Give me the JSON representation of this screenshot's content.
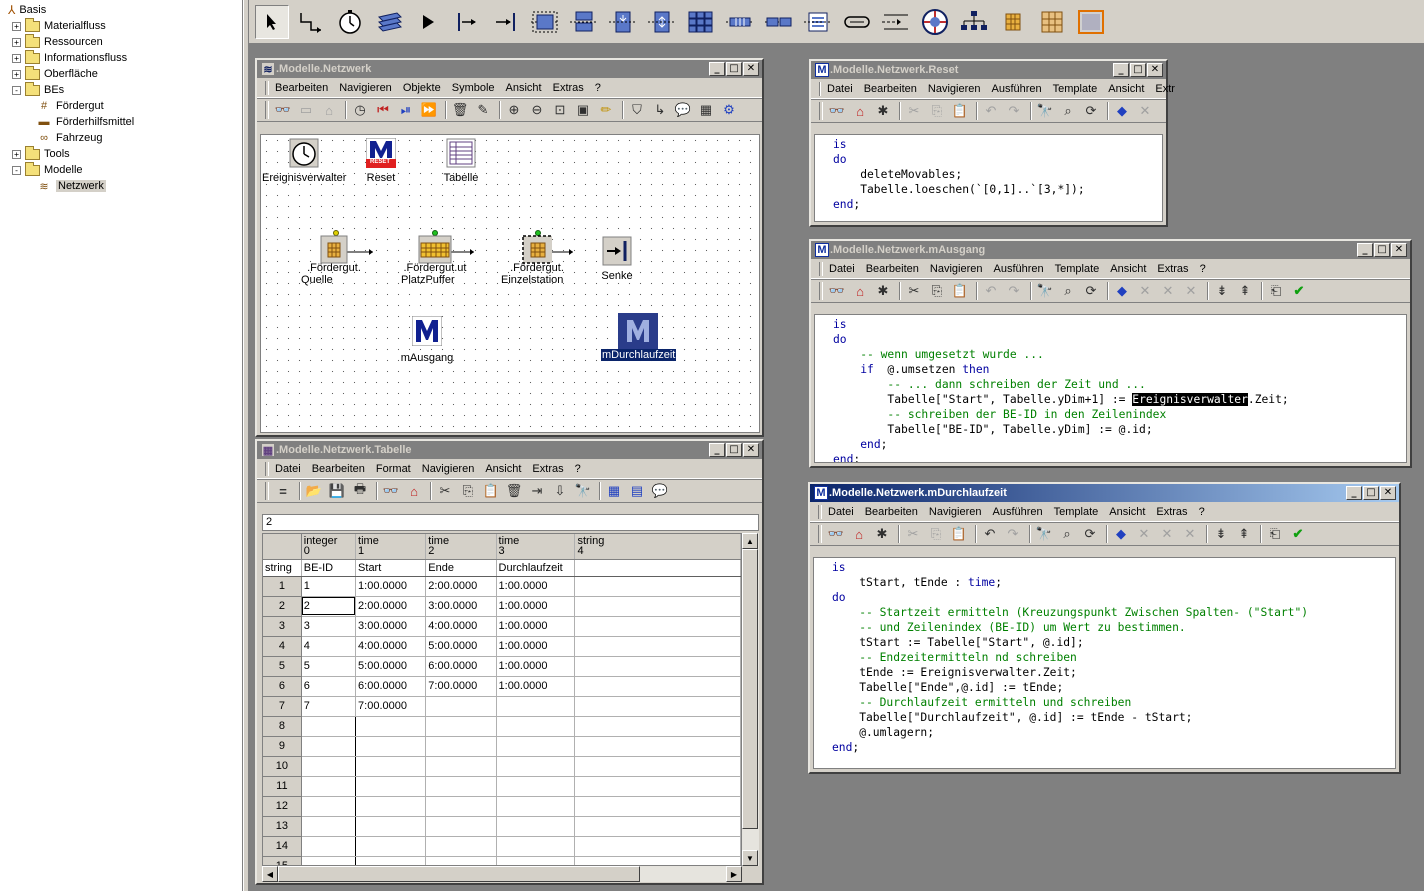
{
  "tree": {
    "root": "Basis",
    "items": [
      {
        "label": "Materialfluss",
        "toggle": "+"
      },
      {
        "label": "Ressourcen",
        "toggle": "+"
      },
      {
        "label": "Informationsfluss",
        "toggle": "+"
      },
      {
        "label": "Oberfläche",
        "toggle": "+"
      },
      {
        "label": "BEs",
        "toggle": "-"
      },
      {
        "label": "Fördergut"
      },
      {
        "label": "Förderhilfsmittel"
      },
      {
        "label": "Fahrzeug"
      },
      {
        "label": "Tools",
        "toggle": "+"
      },
      {
        "label": "Modelle",
        "toggle": "-"
      },
      {
        "label": "Netzwerk",
        "selected": true
      }
    ]
  },
  "netzwerk": {
    "title": ".Modelle.Netzwerk",
    "menu": [
      "Bearbeiten",
      "Navigieren",
      "Objekte",
      "Symbole",
      "Ansicht",
      "Extras",
      "?"
    ],
    "nodes": {
      "ereignisverwalter": "Ereignisverwalter",
      "reset": "Reset",
      "reset_badge": "RESET",
      "tabelle": "Tabelle",
      "quelle_a": ".Fördergut.",
      "quelle_b": "Quelle",
      "puffer_a": ".Fördergut.ut",
      "puffer_b": "PlatzPuffer",
      "einzel_a": ".Fördergut.",
      "einzel_b": "Einzelstation",
      "senke": "Senke",
      "mausgang": "mAusgang",
      "mdurchlauf": "mDurchlaufzeit",
      "m": "M"
    }
  },
  "tabelle": {
    "title": ".Modelle.Netzwerk.Tabelle",
    "menu": [
      "Datei",
      "Bearbeiten",
      "Format",
      "Navigieren",
      "Ansicht",
      "Extras",
      "?"
    ],
    "edit_value": "2",
    "corner": "string",
    "col_types": [
      {
        "t": "integer",
        "n": "0"
      },
      {
        "t": "time",
        "n": "1"
      },
      {
        "t": "time",
        "n": "2"
      },
      {
        "t": "time",
        "n": "3"
      },
      {
        "t": "string",
        "n": "4"
      }
    ],
    "col_names": [
      "BE-ID",
      "Start",
      "Ende",
      "Durchlaufzeit",
      ""
    ],
    "rows": [
      [
        "1",
        "1",
        "1:00.0000",
        "2:00.0000",
        "1:00.0000",
        ""
      ],
      [
        "2",
        "2",
        "2:00.0000",
        "3:00.0000",
        "1:00.0000",
        ""
      ],
      [
        "3",
        "3",
        "3:00.0000",
        "4:00.0000",
        "1:00.0000",
        ""
      ],
      [
        "4",
        "4",
        "4:00.0000",
        "5:00.0000",
        "1:00.0000",
        ""
      ],
      [
        "5",
        "5",
        "5:00.0000",
        "6:00.0000",
        "1:00.0000",
        ""
      ],
      [
        "6",
        "6",
        "6:00.0000",
        "7:00.0000",
        "1:00.0000",
        ""
      ],
      [
        "7",
        "7",
        "7:00.0000",
        "",
        "",
        ""
      ],
      [
        "8",
        "",
        "",
        "",
        "",
        ""
      ],
      [
        "9",
        "",
        "",
        "",
        "",
        ""
      ],
      [
        "10",
        "",
        "",
        "",
        "",
        ""
      ],
      [
        "11",
        "",
        "",
        "",
        "",
        ""
      ],
      [
        "12",
        "",
        "",
        "",
        "",
        ""
      ],
      [
        "13",
        "",
        "",
        "",
        "",
        ""
      ],
      [
        "14",
        "",
        "",
        "",
        "",
        ""
      ],
      [
        "15",
        "",
        "",
        "",
        "",
        ""
      ]
    ]
  },
  "reset": {
    "title": ".Modelle.Netzwerk.Reset",
    "menu": [
      "Datei",
      "Bearbeiten",
      "Navigieren",
      "Ausführen",
      "Template",
      "Ansicht",
      "Extr"
    ]
  },
  "mausgang": {
    "title": ".Modelle.Netzwerk.mAusgang",
    "menu": [
      "Datei",
      "Bearbeiten",
      "Navigieren",
      "Ausführen",
      "Template",
      "Ansicht",
      "Extras",
      "?"
    ]
  },
  "mdurchlauf": {
    "title": ".Modelle.Netzwerk.mDurchlaufzeit",
    "menu": [
      "Datei",
      "Bearbeiten",
      "Navigieren",
      "Ausführen",
      "Template",
      "Ansicht",
      "Extras",
      "?"
    ]
  },
  "code": {
    "reset": [
      [
        [
          "kw",
          "is"
        ]
      ],
      [
        [
          "kw",
          "do"
        ]
      ],
      [
        [
          "",
          "    deleteMovables;"
        ]
      ],
      [
        [
          "",
          "    Tabelle.loeschen(`[0,1]..`[3,*]);"
        ]
      ],
      [
        [
          "kw",
          "end"
        ],
        [
          "",
          ";"
        ]
      ]
    ],
    "mausgang": [
      [
        [
          "kw",
          "is"
        ]
      ],
      [
        [
          "kw",
          "do"
        ]
      ],
      [
        [
          "cm",
          "    -- wenn umgesetzt wurde ..."
        ]
      ],
      [
        [
          "",
          "    "
        ],
        [
          "kw",
          "if"
        ],
        [
          "",
          "  @.umsetzen "
        ],
        [
          "kw",
          "then"
        ]
      ],
      [
        [
          "cm",
          "        -- ... dann schreiben der Zeit und ..."
        ]
      ],
      [
        [
          "",
          "        Tabelle[\"Start\", Tabelle.yDim+1] := "
        ],
        [
          "hl",
          "Ereignisverwalter"
        ],
        [
          "",
          ".Zeit;"
        ]
      ],
      [
        [
          "cm",
          "        -- schreiben der BE-ID in den Zeilenindex"
        ]
      ],
      [
        [
          "",
          "        Tabelle[\"BE-ID\", Tabelle.yDim] := @.id;"
        ]
      ],
      [
        [
          "",
          "    "
        ],
        [
          "kw",
          "end"
        ],
        [
          "",
          ";"
        ]
      ],
      [
        [
          "kw",
          "end"
        ],
        [
          "",
          ";"
        ]
      ]
    ],
    "mdurchlauf": [
      [
        [
          "kw",
          "is"
        ]
      ],
      [
        [
          "",
          "    tStart, tEnde : "
        ],
        [
          "kw",
          "time"
        ],
        [
          "",
          ";"
        ]
      ],
      [
        [
          "kw",
          "do"
        ]
      ],
      [
        [
          "cm",
          "    -- Startzeit ermitteln (Kreuzungspunkt Zwischen Spalten- (\"Start\")"
        ]
      ],
      [
        [
          "cm",
          "    -- und Zeilenindex (BE-ID) um Wert zu bestimmen."
        ]
      ],
      [
        [
          "",
          "    tStart := Tabelle[\"Start\", @.id];"
        ]
      ],
      [
        [
          "cm",
          "    -- Endzeitermitteln nd schreiben"
        ]
      ],
      [
        [
          "",
          "    tEnde := Ereignisverwalter.Zeit;"
        ]
      ],
      [
        [
          "",
          "    Tabelle[\"Ende\",@.id] := tEnde;"
        ]
      ],
      [
        [
          "cm",
          "    -- Durchlaufzeit ermitteln und schreiben"
        ]
      ],
      [
        [
          "",
          "    Tabelle[\"Durchlaufzeit\", @.id] := tEnde - tStart;"
        ]
      ],
      [
        [
          "",
          "    @.umlagern;"
        ]
      ],
      [
        [
          "kw",
          "end"
        ],
        [
          "",
          ";"
        ]
      ]
    ]
  }
}
